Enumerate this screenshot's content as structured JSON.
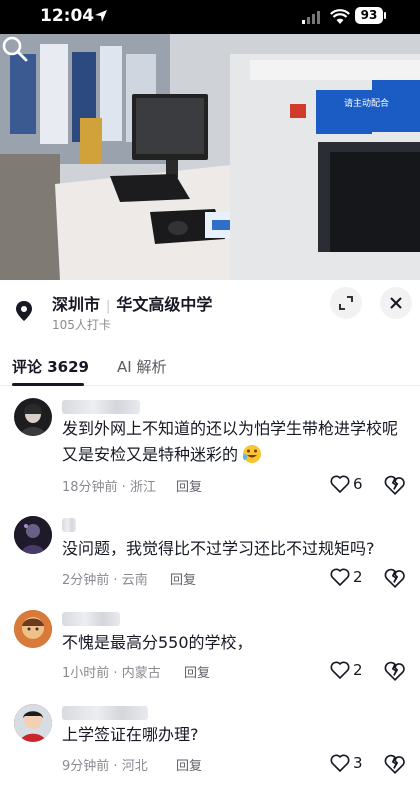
{
  "status_bar": {
    "time": "12:04",
    "battery": "93"
  },
  "video": {
    "sign_text": "请主动配合"
  },
  "location": {
    "city": "深圳市",
    "place": "华文高级中学",
    "checkins": "105人打卡"
  },
  "tabs": [
    {
      "label": "评论 3629",
      "active": true
    },
    {
      "label": "AI 解析",
      "active": false
    }
  ],
  "comments": [
    {
      "text": "发到外网上不知道的还以为怕学生带枪进学校呢又是安检又是特种迷彩的",
      "emoji": "rolling-laughing",
      "time": "18分钟前",
      "region": "浙江",
      "reply": "回复",
      "likes": "6"
    },
    {
      "text": "没问题，我觉得比不过学习还比不过规矩吗?",
      "time": "2分钟前",
      "region": "云南",
      "reply": "回复",
      "likes": "2"
    },
    {
      "text": "不愧是最高分550的学校，",
      "time": "1小时前",
      "region": "内蒙古",
      "reply": "回复",
      "likes": "2"
    },
    {
      "text": "上学签证在哪办理?",
      "time": "9分钟前",
      "region": "河北",
      "reply": "回复",
      "likes": "3"
    }
  ],
  "colors": {
    "accent_text": "#161823",
    "meta_text": "#8a8b91",
    "divider": "#ececee"
  }
}
